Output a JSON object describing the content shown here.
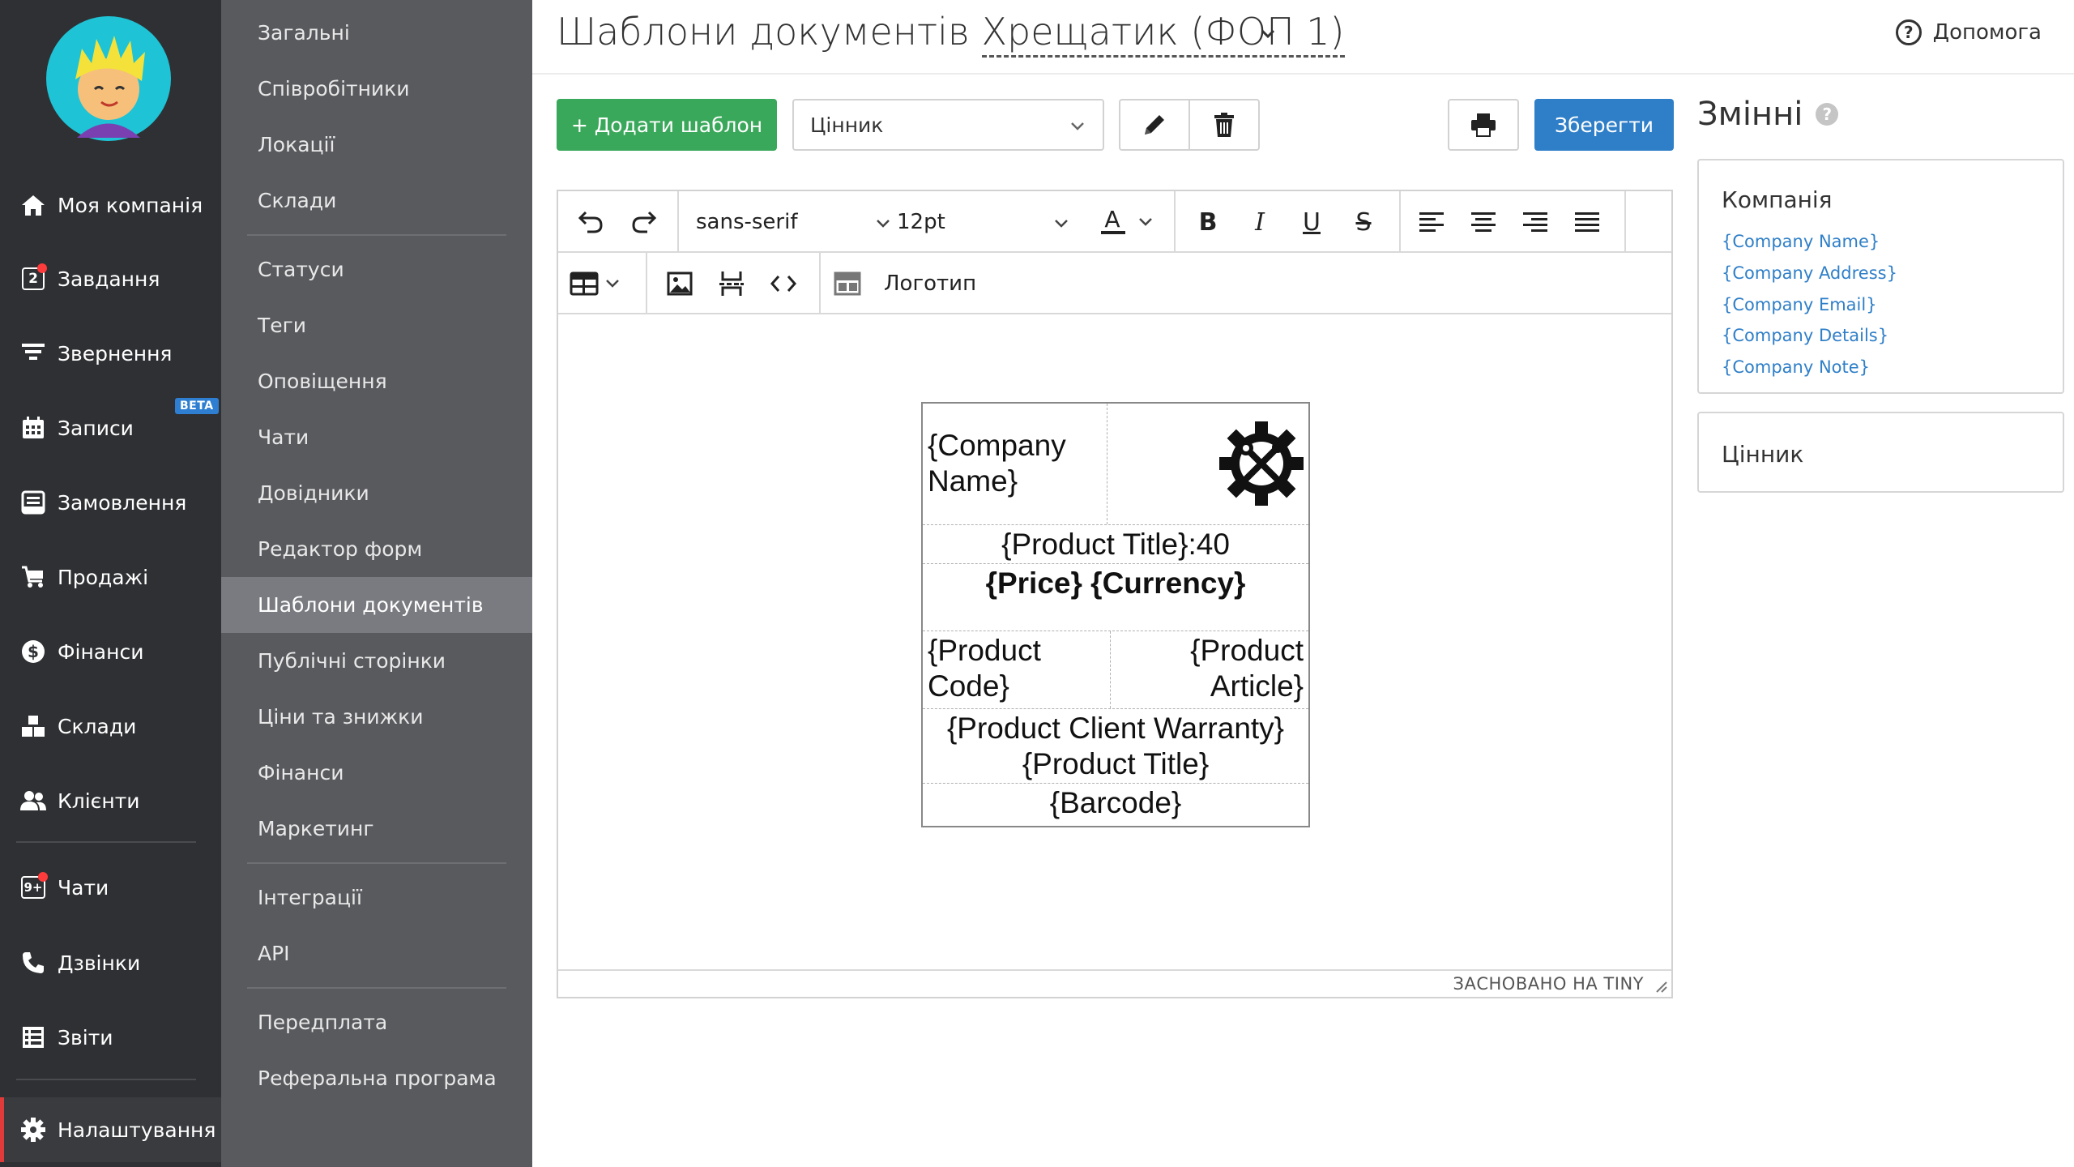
{
  "sidebar": {
    "items": [
      {
        "label": "Моя компанія",
        "icon": "home-icon"
      },
      {
        "label": "Завдання",
        "icon": "tasks-icon",
        "badge": "2"
      },
      {
        "label": "Звернення",
        "icon": "funnel-icon"
      },
      {
        "label": "Записи",
        "icon": "calendar-icon",
        "tag": "BETA"
      },
      {
        "label": "Замовлення",
        "icon": "orders-icon"
      },
      {
        "label": "Продажі",
        "icon": "cart-icon"
      },
      {
        "label": "Фінанси",
        "icon": "dollar-icon"
      },
      {
        "label": "Склади",
        "icon": "boxes-icon"
      },
      {
        "label": "Клієнти",
        "icon": "users-icon"
      },
      {
        "label": "Чати",
        "icon": "chat-icon",
        "badge": "9+"
      },
      {
        "label": "Дзвінки",
        "icon": "phone-icon"
      },
      {
        "label": "Звіти",
        "icon": "reports-icon"
      },
      {
        "label": "Налаштування",
        "icon": "gear-icon"
      }
    ]
  },
  "submenu": {
    "items": [
      "Загальні",
      "Співробітники",
      "Локації",
      "Склади",
      "Статуси",
      "Теги",
      "Оповіщення",
      "Чати",
      "Довідники",
      "Редактор форм",
      "Шаблони документів",
      "Публічні сторінки",
      "Ціни та знижки",
      "Фінанси",
      "Маркетинг",
      "Інтеграції",
      "API",
      "Передплата",
      "Реферальна програма"
    ]
  },
  "header": {
    "title": "Шаблони документів",
    "company": "Хрещатик (ФОП 1)",
    "help": "Допомога"
  },
  "toolbar": {
    "add_label": "+ Додати шаблон",
    "selected_template": "Цінник",
    "save_label": "Зберегти"
  },
  "editor": {
    "font_family": "sans-serif",
    "font_size": "12pt",
    "logo_label": "Логотип",
    "powered_by": "ЗАСНОВАНО НА TINY",
    "label": {
      "company_name": "{Company Name}",
      "product_title_row": "{Product Title}:40",
      "price_row": "{Price} {Currency}",
      "product_code": "{Product Code}",
      "product_article": "{Product Article}",
      "warranty": "{Product Client Warranty}",
      "product_title": "{Product Title}",
      "barcode": "{Barcode}"
    }
  },
  "variables": {
    "title": "Змінні",
    "company_panel": {
      "title": "Компанія",
      "items": [
        "{Company Name}",
        "{Company Address}",
        "{Company Email}",
        "{Company Details}",
        "{Company Note}"
      ]
    },
    "price_panel": {
      "title": "Цінник"
    }
  },
  "colors": {
    "sidebar_bg": "#2f3033",
    "submenu_bg": "#595a5e",
    "submenu_active": "#7a7b80",
    "add_button": "#3aa85a",
    "save_button": "#2f7fc8",
    "link": "#2f7fc8",
    "active_marker": "#e03b3b"
  }
}
